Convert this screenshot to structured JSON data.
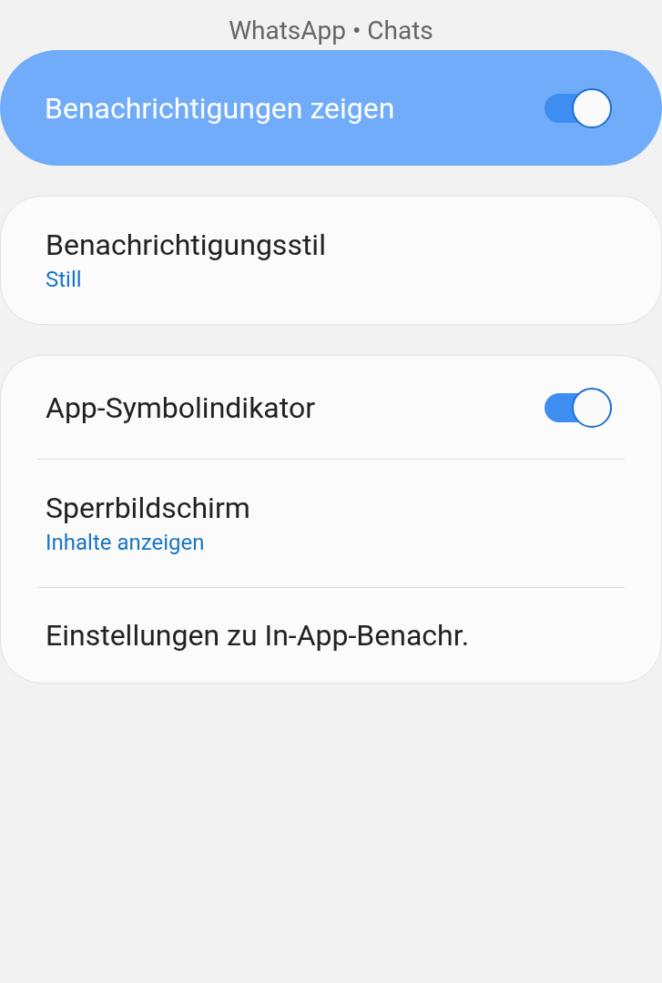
{
  "header": {
    "title": "WhatsApp • Chats"
  },
  "master": {
    "label": "Benachrichtigungen zeigen",
    "on": true
  },
  "groups": [
    {
      "items": [
        {
          "kind": "link",
          "label": "Benachrichtigungsstil",
          "summary": "Still"
        }
      ]
    },
    {
      "items": [
        {
          "kind": "switch",
          "label": "App-Symbolindikator",
          "on": true
        },
        {
          "kind": "link",
          "label": "Sperrbildschirm",
          "summary": "Inhalte anzeigen"
        },
        {
          "kind": "link",
          "label": "Einstellungen zu In-App-Benachr."
        }
      ]
    }
  ]
}
